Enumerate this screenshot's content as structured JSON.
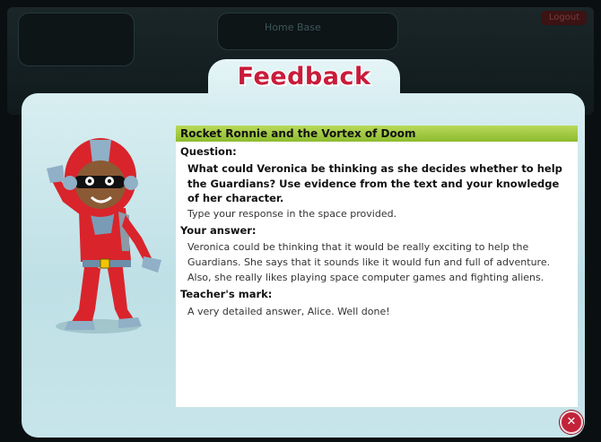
{
  "background": {
    "logout_label": "Logout",
    "home_label": "Home Base"
  },
  "dialog": {
    "title": "Feedback",
    "book_title": "Rocket Ronnie and the Vortex of Doom",
    "question_label": "Question:",
    "question_text": "What could Veronica be thinking as she decides whether to help the Guardians? Use evidence from the text and your knowledge of her character.",
    "question_instruction": "Type your response in the space provided.",
    "answer_label": "Your answer:",
    "answer_lines": [
      "Veronica could be thinking that it would be really exciting to help the",
      "Guardians. She says that it sounds like it would fun and full of adventure.",
      "Also, she really likes playing space computer games and fighting aliens."
    ],
    "mark_label": "Teacher's mark:",
    "mark_text": "A very detailed answer, Alice. Well done!",
    "close_icon": "close-icon"
  },
  "colors": {
    "title_red": "#c91b3a",
    "header_green": "#9cc83d",
    "panel_blue": "#c9e6eb"
  }
}
